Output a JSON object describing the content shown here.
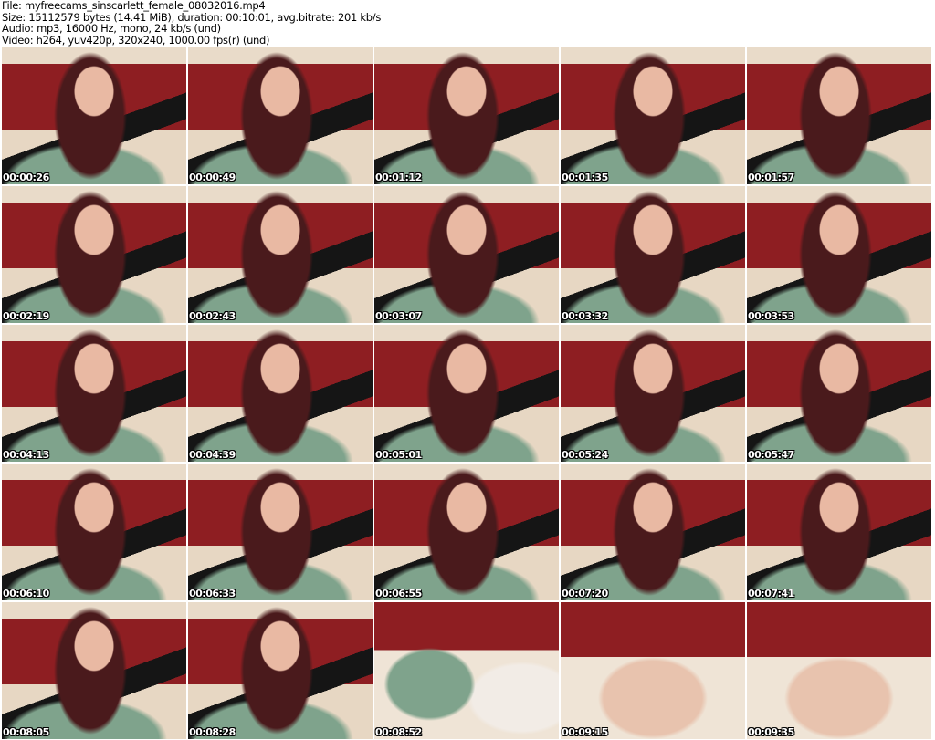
{
  "header": {
    "file": "File: myfreecams_sinscarlett_female_08032016.mp4",
    "size": "Size: 15112579 bytes (14.41 MiB), duration: 00:10:01, avg.bitrate: 201 kb/s",
    "audio": "Audio: mp3, 16000 Hz, mono, 24 kb/s (und)",
    "video": "Video: h264, yuv420p, 320x240, 1000.00 fps(r) (und)"
  },
  "thumbnails": [
    "00:00:26",
    "00:00:49",
    "00:01:12",
    "00:01:35",
    "00:01:57",
    "00:02:19",
    "00:02:43",
    "00:03:07",
    "00:03:32",
    "00:03:53",
    "00:04:13",
    "00:04:39",
    "00:05:01",
    "00:05:24",
    "00:05:47",
    "00:06:10",
    "00:06:33",
    "00:06:55",
    "00:07:20",
    "00:07:41",
    "00:08:05",
    "00:08:28",
    "00:08:52",
    "00:09:15",
    "00:09:35"
  ]
}
